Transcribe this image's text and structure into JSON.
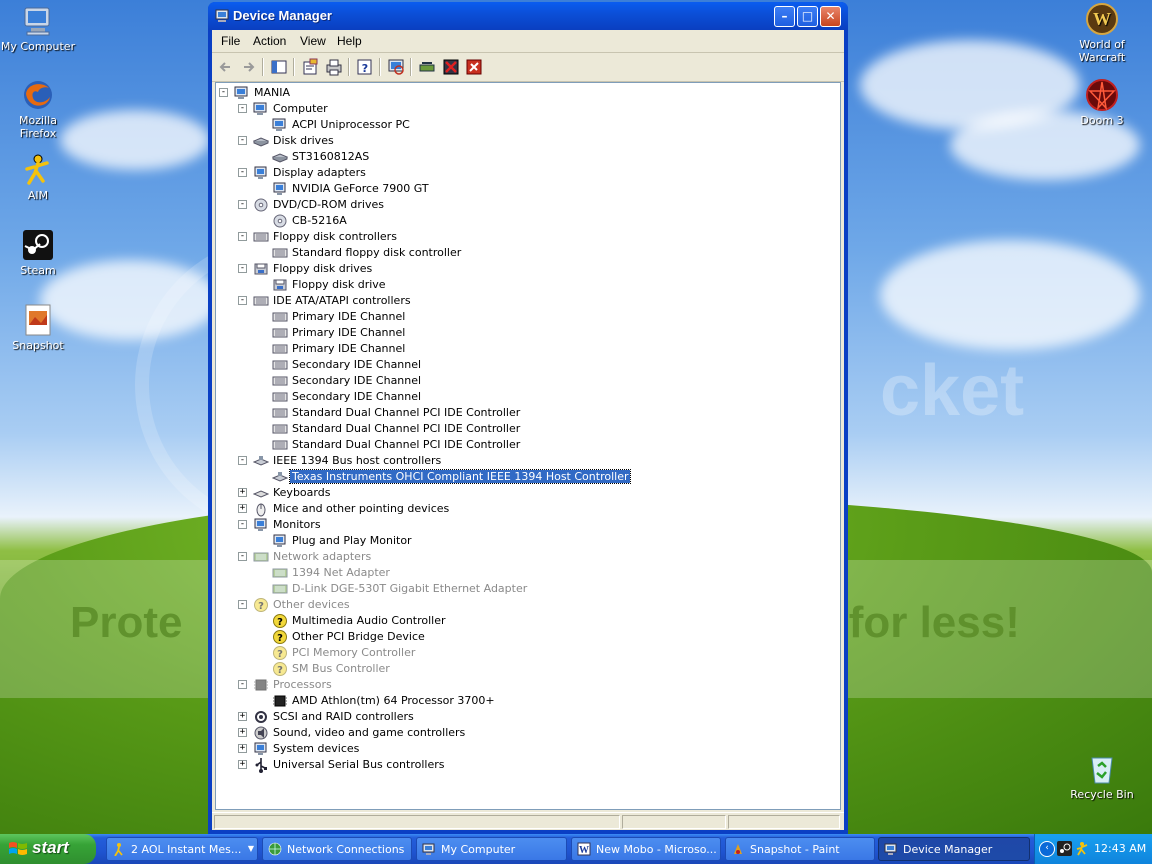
{
  "desktop": {
    "icons_left": [
      {
        "label": "My Computer"
      },
      {
        "label": "Mozilla Firefox"
      },
      {
        "label": "AIM"
      },
      {
        "label": "Steam"
      },
      {
        "label": "Snapshot"
      }
    ],
    "icons_right": [
      {
        "label": "World of Warcraft"
      },
      {
        "label": "Doom 3"
      },
      {
        "label": "Recycle Bin"
      }
    ],
    "banner": {
      "left": "Prote",
      "right": "s for less!"
    },
    "watermark": "cket"
  },
  "window": {
    "title": "Device Manager",
    "menu": [
      "File",
      "Action",
      "View",
      "Help"
    ],
    "tree": [
      {
        "label": "MANIA",
        "level": 0,
        "expander": "-",
        "icon": "computer-icon"
      },
      {
        "label": "Computer",
        "level": 1,
        "expander": "-",
        "icon": "computer-icon"
      },
      {
        "label": "ACPI Uniprocessor PC",
        "level": 2,
        "icon": "computer-icon"
      },
      {
        "label": "Disk drives",
        "level": 1,
        "expander": "-",
        "icon": "disk-drive-icon"
      },
      {
        "label": "ST3160812AS",
        "level": 2,
        "icon": "disk-drive-icon"
      },
      {
        "label": "Display adapters",
        "level": 1,
        "expander": "-",
        "icon": "display-adapter-icon"
      },
      {
        "label": "NVIDIA GeForce 7900 GT",
        "level": 2,
        "icon": "display-adapter-icon"
      },
      {
        "label": "DVD/CD-ROM drives",
        "level": 1,
        "expander": "-",
        "icon": "cd-drive-icon"
      },
      {
        "label": "CB-5216A",
        "level": 2,
        "icon": "cd-drive-icon"
      },
      {
        "label": "Floppy disk controllers",
        "level": 1,
        "expander": "-",
        "icon": "controller-icon"
      },
      {
        "label": "Standard floppy disk controller",
        "level": 2,
        "icon": "controller-icon"
      },
      {
        "label": "Floppy disk drives",
        "level": 1,
        "expander": "-",
        "icon": "floppy-drive-icon"
      },
      {
        "label": "Floppy disk drive",
        "level": 2,
        "icon": "floppy-drive-icon"
      },
      {
        "label": "IDE ATA/ATAPI controllers",
        "level": 1,
        "expander": "-",
        "icon": "controller-icon"
      },
      {
        "label": "Primary IDE Channel",
        "level": 2,
        "icon": "controller-icon"
      },
      {
        "label": "Primary IDE Channel",
        "level": 2,
        "icon": "controller-icon"
      },
      {
        "label": "Primary IDE Channel",
        "level": 2,
        "icon": "controller-icon"
      },
      {
        "label": "Secondary IDE Channel",
        "level": 2,
        "icon": "controller-icon"
      },
      {
        "label": "Secondary IDE Channel",
        "level": 2,
        "icon": "controller-icon"
      },
      {
        "label": "Secondary IDE Channel",
        "level": 2,
        "icon": "controller-icon"
      },
      {
        "label": "Standard Dual Channel PCI IDE Controller",
        "level": 2,
        "icon": "controller-icon"
      },
      {
        "label": "Standard Dual Channel PCI IDE Controller",
        "level": 2,
        "icon": "controller-icon"
      },
      {
        "label": "Standard Dual Channel PCI IDE Controller",
        "level": 2,
        "icon": "controller-icon"
      },
      {
        "label": "IEEE 1394 Bus host controllers",
        "level": 1,
        "expander": "-",
        "icon": "bus-controller-icon"
      },
      {
        "label": "Texas Instruments OHCI Compliant IEEE 1394 Host Controller",
        "level": 2,
        "icon": "bus-controller-icon",
        "selected": true
      },
      {
        "label": "Keyboards",
        "level": 1,
        "expander": "+",
        "icon": "keyboard-icon"
      },
      {
        "label": "Mice and other pointing devices",
        "level": 1,
        "expander": "+",
        "icon": "mouse-icon"
      },
      {
        "label": "Monitors",
        "level": 1,
        "expander": "-",
        "icon": "monitor-icon"
      },
      {
        "label": "Plug and Play Monitor",
        "level": 2,
        "icon": "monitor-icon"
      },
      {
        "label": "Network adapters",
        "level": 1,
        "expander": "-",
        "icon": "network-adapter-icon",
        "dim": true
      },
      {
        "label": "1394 Net Adapter",
        "level": 2,
        "icon": "network-adapter-icon",
        "dim": true
      },
      {
        "label": "D-Link DGE-530T Gigabit Ethernet Adapter",
        "level": 2,
        "icon": "network-adapter-icon",
        "dim": true
      },
      {
        "label": "Other devices",
        "level": 1,
        "expander": "-",
        "icon": "unknown-device-icon",
        "dim": true
      },
      {
        "label": "Multimedia Audio Controller",
        "level": 2,
        "icon": "unknown-device-icon"
      },
      {
        "label": "Other PCI Bridge Device",
        "level": 2,
        "icon": "unknown-device-icon"
      },
      {
        "label": "PCI Memory Controller",
        "level": 2,
        "icon": "unknown-device-icon",
        "dim": true
      },
      {
        "label": "SM Bus Controller",
        "level": 2,
        "icon": "unknown-device-icon",
        "dim": true
      },
      {
        "label": "Processors",
        "level": 1,
        "expander": "-",
        "icon": "processor-icon",
        "dim": true
      },
      {
        "label": "AMD Athlon(tm) 64 Processor 3700+",
        "level": 2,
        "icon": "processor-icon"
      },
      {
        "label": "SCSI and RAID controllers",
        "level": 1,
        "expander": "+",
        "icon": "scsi-icon"
      },
      {
        "label": "Sound, video and game controllers",
        "level": 1,
        "expander": "+",
        "icon": "sound-icon"
      },
      {
        "label": "System devices",
        "level": 1,
        "expander": "+",
        "icon": "system-device-icon"
      },
      {
        "label": "Universal Serial Bus controllers",
        "level": 1,
        "expander": "+",
        "icon": "usb-icon"
      }
    ]
  },
  "taskbar": {
    "start_label": "start",
    "tasks": [
      {
        "label": "2 AOL Instant Mes...",
        "icon": "aim-icon"
      },
      {
        "label": "Network Connections",
        "icon": "network-icon"
      },
      {
        "label": "My Computer",
        "icon": "computer-icon"
      },
      {
        "label": "New Mobo - Microso...",
        "icon": "word-icon"
      },
      {
        "label": "Snapshot - Paint",
        "icon": "paint-icon"
      },
      {
        "label": "Device Manager",
        "icon": "device-manager-icon",
        "active": true
      }
    ],
    "clock": "12:43 AM"
  },
  "colors": {
    "selection": "#316ac5",
    "titlebar": "#0a4fd8",
    "taskbar": "#245edb"
  }
}
